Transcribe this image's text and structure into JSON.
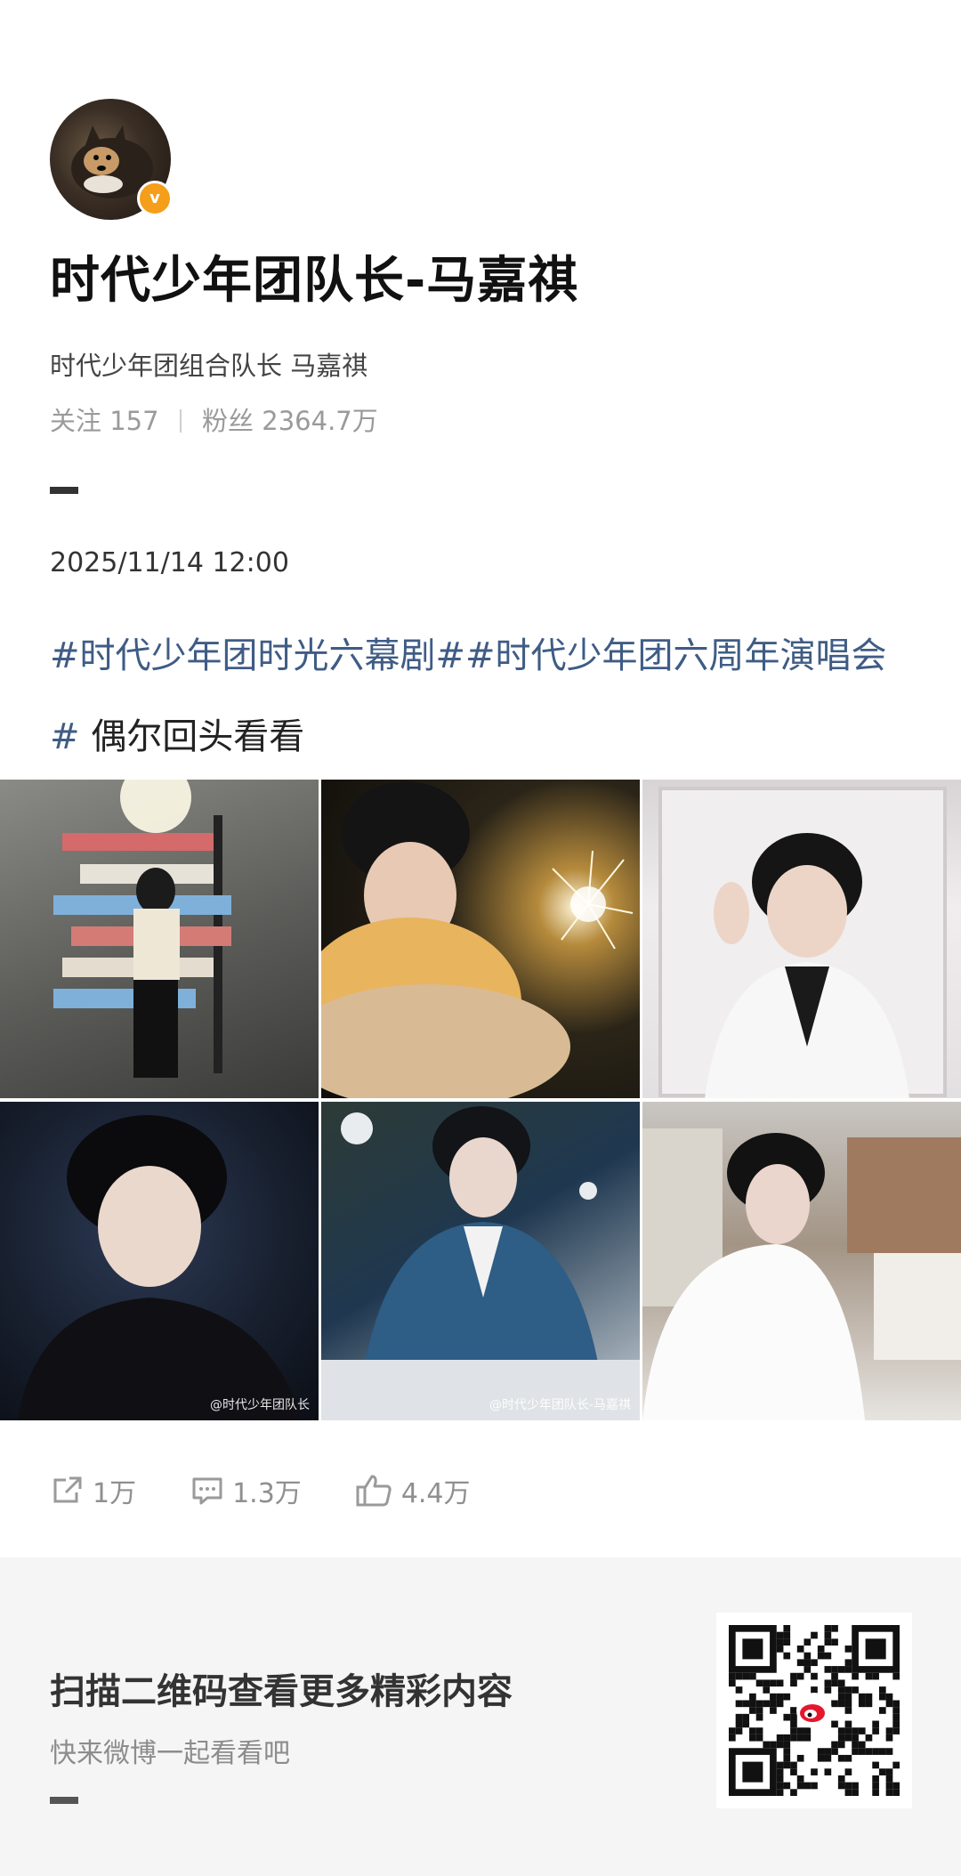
{
  "profile": {
    "avatar_icon": "avatar-dog-photo",
    "verified_icon": "verified-badge-icon",
    "verified_glyph": "v",
    "name": "时代少年团队长-马嘉祺",
    "description": "时代少年团组合队长 马嘉祺",
    "following_label": "关注",
    "following_count": "157",
    "followers_label": "粉丝",
    "followers_count": "2364.7万"
  },
  "post": {
    "timestamp": "2025/11/14 12:00",
    "hashtag1": "#时代少年团时光六幕剧#",
    "hashtag2": "#时代少年团六周年演唱会#",
    "text": " 偶尔回头看看",
    "images": [
      {
        "watermark": ""
      },
      {
        "watermark": ""
      },
      {
        "watermark": ""
      },
      {
        "watermark": "@时代少年团队长"
      },
      {
        "watermark": "@时代少年团队长-马嘉祺"
      },
      {
        "watermark": ""
      }
    ]
  },
  "actions": {
    "repost_count": "1万",
    "comment_count": "1.3万",
    "like_count": "4.4万"
  },
  "promo": {
    "title": "扫描二维码查看更多精彩内容",
    "subtitle": "快来微博一起看看吧",
    "qr_icon": "qr-code-icon"
  },
  "colors": {
    "hashtag": "#3f5c85",
    "badge": "#f59e1a",
    "weibo_red": "#e6162d"
  }
}
